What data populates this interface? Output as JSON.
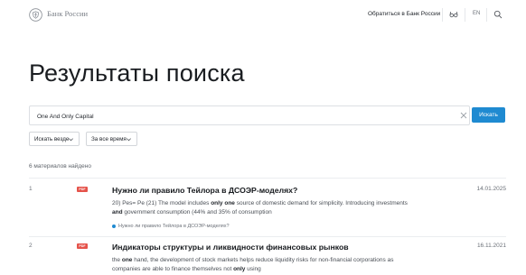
{
  "header": {
    "brand": "Банк России",
    "appeal_link": "Обратиться в Банк России",
    "lang": "EN"
  },
  "page_title": "Результаты поиска",
  "search": {
    "value": "One And Only Capital",
    "button_label": "Искать"
  },
  "filters": {
    "scope": "Искать везде",
    "period": "За все время"
  },
  "results_count": "6 материалов найдено",
  "results": [
    {
      "num": "1",
      "badge": "PDF",
      "title": "Нужно ли правило Тейлора в ДСОЭР-моделях?",
      "date": "14.01.2025",
      "snippet": [
        {
          "t": "20) Pes= Pe (21) The model includes ",
          "b": false
        },
        {
          "t": "only one",
          "b": true
        },
        {
          "t": " source of domestic demand for simplicity. Introducing investments ",
          "b": false
        },
        {
          "t": "and",
          "b": true
        },
        {
          "t": " government consumption (44% and 35% of consumption",
          "b": false
        }
      ],
      "source": "Нужно ли правило Тейлора в ДСОЭР-моделях?"
    },
    {
      "num": "2",
      "badge": "PDF",
      "title": "Индикаторы структуры и ликвидности финансовых рынков",
      "date": "16.11.2021",
      "snippet": [
        {
          "t": "the ",
          "b": false
        },
        {
          "t": "one",
          "b": true
        },
        {
          "t": " hand, the development of stock markets helps reduce liquidity risks for non-financial corporations as companies are able to finance themselves not ",
          "b": false
        },
        {
          "t": "only",
          "b": true
        },
        {
          "t": " using",
          "b": false
        }
      ]
    }
  ]
}
